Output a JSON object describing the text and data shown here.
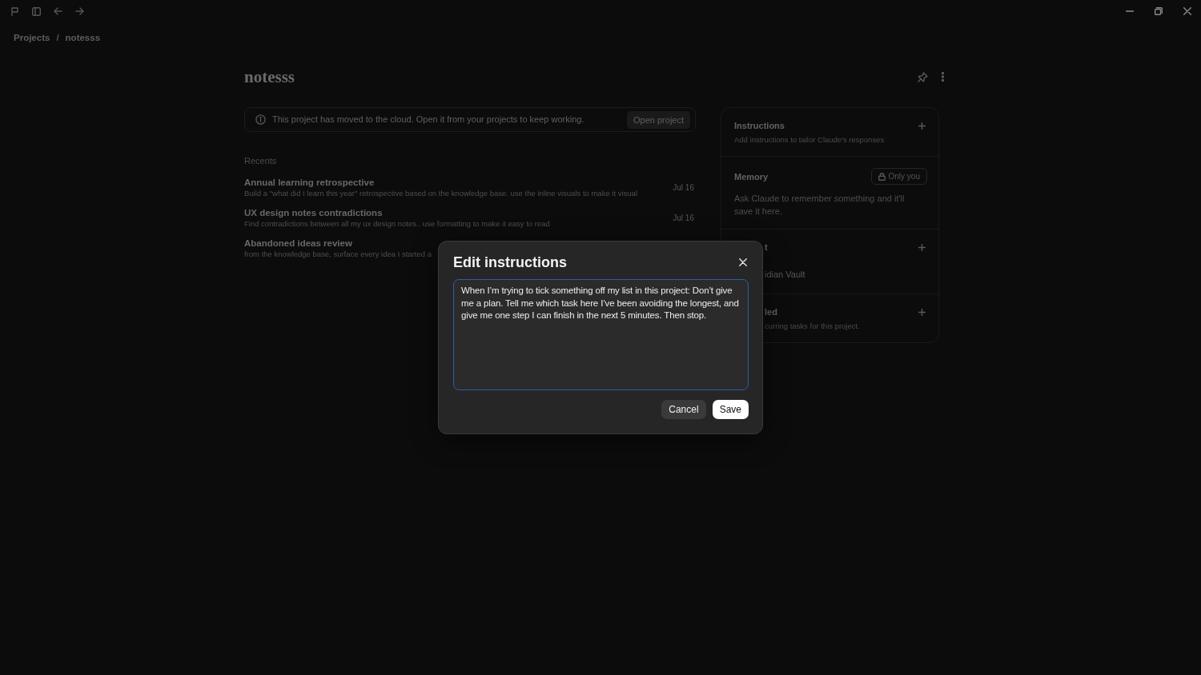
{
  "breadcrumb": {
    "items": [
      "Projects",
      "notesss"
    ],
    "separator": "/"
  },
  "project": {
    "title": "notesss"
  },
  "banner": {
    "message": "This project has moved to the cloud. Open it from your projects to keep working.",
    "button": "Open project"
  },
  "recents": {
    "heading": "Recents",
    "items": [
      {
        "title": "Annual learning retrospective",
        "description": "Build a \"what did I learn this year\" retrospective based on the knowledge base. use the inline visuals to make it visual",
        "date": "Jul 16"
      },
      {
        "title": "UX design notes contradictions",
        "description": "Find contradictions between all my ux design notes.. use formatting to make it easy to read",
        "date": "Jul 16"
      },
      {
        "title": "Abandoned ideas review",
        "description": "from the knowledge base, surface every idea I started a"
      }
    ]
  },
  "side_panel": {
    "sections": [
      {
        "title": "Instructions",
        "add_button": true,
        "covered": false,
        "text": "Add instructions to tailor Claude's responses"
      },
      {
        "title": "Memory",
        "add_button": false,
        "covered": false,
        "badge": "Only you",
        "text": "Ask Claude to remember something and it'll save it here."
      },
      {
        "title": "t",
        "add_button": true,
        "covered": true,
        "items": [
          "idian Vault"
        ]
      },
      {
        "title": "led",
        "add_button": true,
        "covered": true,
        "text": "curring tasks for this project."
      }
    ]
  },
  "dialog": {
    "title": "Edit instructions",
    "value": "When I’m trying to tick something off my list in this project: Don’t give me a plan. Tell me which task here I’ve been avoiding the longest, and give me one step I can finish in the next 5 minutes. Then stop.",
    "focused": true,
    "buttons": [
      {
        "label": "Cancel",
        "kind": "secondary"
      },
      {
        "label": "Save",
        "kind": "primary"
      }
    ]
  }
}
